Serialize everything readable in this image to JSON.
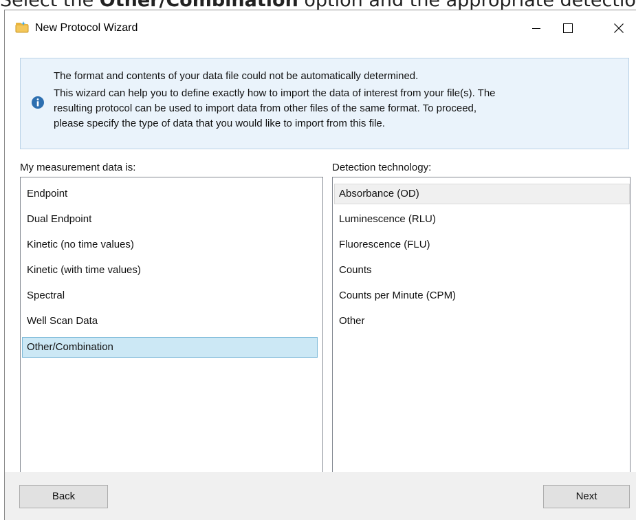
{
  "background": {
    "instruction_prefix": "Select the ",
    "instruction_bold": "Other/Combination",
    "instruction_suffix": " option and the appropriate detection"
  },
  "window": {
    "title": "New Protocol Wizard",
    "controls": {
      "minimize": "minimize-icon",
      "maximize": "maximize-icon",
      "close": "close-icon"
    }
  },
  "info": {
    "icon": "info-icon",
    "lines": [
      "The format and contents of your data file could not be automatically determined.",
      "This wizard can help you to define exactly how to import the data of interest from your file(s). The",
      "resulting protocol can be used to import data from other files of the same format. To proceed,",
      "please specify the type of data that you would like to import from this file."
    ]
  },
  "measurement": {
    "label": "My measurement data is:",
    "items": [
      "Endpoint",
      "Dual Endpoint",
      "Kinetic (no time values)",
      "Kinetic (with time values)",
      "Spectral",
      "Well Scan Data",
      "Other/Combination"
    ],
    "selected": "Other/Combination"
  },
  "detection": {
    "label": "Detection technology:",
    "items": [
      "Absorbance (OD)",
      "Luminescence (RLU)",
      "Fluorescence (FLU)",
      "Counts",
      "Counts per Minute (CPM)",
      "Other"
    ],
    "highlighted": "Absorbance (OD)"
  },
  "buttons": {
    "back": "Back",
    "next": "Next"
  },
  "colors": {
    "selection": "#cce8f5",
    "selection_border": "#7ebad9",
    "info_bg": "#eaf3fb",
    "footer_bg": "#f0f0f0"
  }
}
